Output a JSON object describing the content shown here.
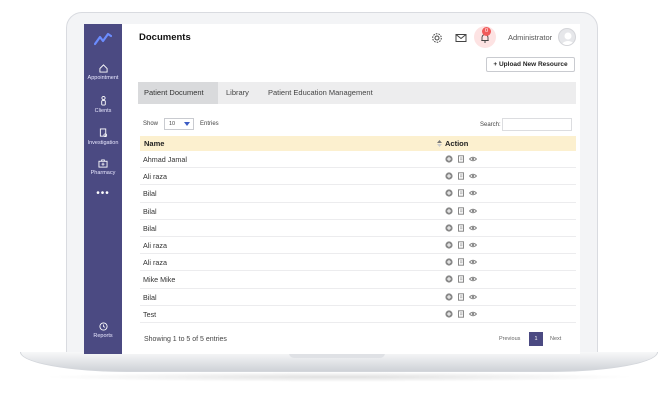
{
  "sidebar": {
    "items": [
      {
        "label": "Appointment",
        "icon": "home-icon"
      },
      {
        "label": "Clients",
        "icon": "person-icon"
      },
      {
        "label": "Investigation",
        "icon": "document-icon"
      },
      {
        "label": "Pharmacy",
        "icon": "medkit-icon"
      }
    ],
    "more": "•••",
    "bottom": {
      "label": "Reports",
      "icon": "clock-icon"
    }
  },
  "header": {
    "title": "Documents",
    "notification_count": "0",
    "user": "Administrator",
    "upload_label": "Upload New Resource"
  },
  "tabs": [
    {
      "label": "Patient Document",
      "active": true
    },
    {
      "label": "Library",
      "active": false
    },
    {
      "label": "Patient Education Management",
      "active": false
    }
  ],
  "controls": {
    "show_label": "Show",
    "entries_value": "10",
    "entries_label": "Entries",
    "search_label": "Search:"
  },
  "table": {
    "columns": [
      "Name",
      "Action"
    ],
    "rows": [
      {
        "name": "Ahmad Jamal"
      },
      {
        "name": "Ali raza"
      },
      {
        "name": "Bilal"
      },
      {
        "name": "Bilal"
      },
      {
        "name": "Bilal"
      },
      {
        "name": "Ali raza"
      },
      {
        "name": "Ali raza"
      },
      {
        "name": "Mike Mike"
      },
      {
        "name": "Bilal"
      },
      {
        "name": "Test"
      }
    ]
  },
  "footer": {
    "showing": "Showing 1 to 5 of 5 entries",
    "previous": "Previous",
    "page": "1",
    "next": "Next"
  },
  "colors": {
    "sidebar": "#4b4a82",
    "header_row": "#fcf0cf",
    "badge": "#f05a5a"
  }
}
